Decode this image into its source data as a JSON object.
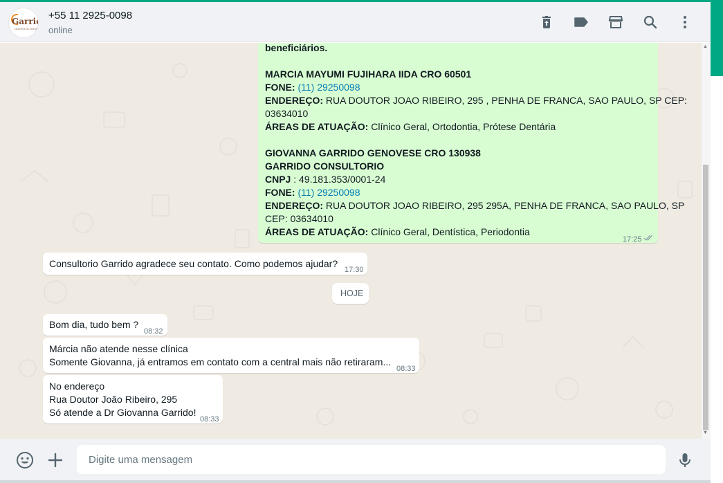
{
  "contact": {
    "name": "+55 11 2925-0098",
    "status": "online",
    "avatar_brand": "Garrido",
    "avatar_sub": "ODONTOLOGIA"
  },
  "header_icons": [
    "delete-icon",
    "label-icon",
    "store-icon",
    "search-icon",
    "menu-icon"
  ],
  "messages": {
    "m1": {
      "lines": {
        "l0": "beneficiários.",
        "l1": "MARCIA MAYUMI FUJIHARA IIDA CRO 60501",
        "l2_k": "FONE:",
        "l2_v": "(11) 29250098",
        "l3_k": "ENDEREÇO:",
        "l3_v": "RUA DOUTOR JOAO RIBEIRO, 295 , PENHA DE FRANCA, SAO PAULO, SP CEP:",
        "l4": "03634010",
        "l5_k": "ÁREAS DE ATUAÇÃO:",
        "l5_v": "Clínico Geral, Ortodontia, Prótese Dentária",
        "l6": "GIOVANNA GARRIDO GENOVESE CRO 130938",
        "l7": "GARRIDO CONSULTORIO",
        "l8_k": "CNPJ",
        "l8_v": ": 49.181.353/0001-24",
        "l9_k": "FONE:",
        "l9_v": "(11) 29250098",
        "l10_k": "ENDEREÇO:",
        "l10_v": "RUA DOUTOR JOAO RIBEIRO, 295 295A, PENHA DE FRANCA, SAO PAULO, SP",
        "l11": "CEP: 03634010",
        "l12_k": "ÁREAS DE ATUAÇÃO:",
        "l12_v": "Clínico Geral, Dentística, Periodontia"
      },
      "time": "17:25"
    },
    "m2": {
      "text": "Consultorio Garrido agradece seu contato. Como podemos ajudar?",
      "time": "17:30"
    },
    "date_divider": "HOJE",
    "m3": {
      "text": "Bom dia, tudo bem ?",
      "time": "08:32"
    },
    "m4": {
      "line1": "Márcia não atende nesse clínica",
      "line2": "Somente Giovanna, já entramos em contato com a central mais não retiraram...",
      "time": "08:33"
    },
    "m5": {
      "line1": "No endereço",
      "line2": "Rua Doutor João Ribeiro, 295",
      "line3": "Só atende a Dr Giovanna Garrido!",
      "time": "08:33"
    }
  },
  "composer": {
    "placeholder": "Digite uma mensagem"
  },
  "colors": {
    "header_bg": "#f0f2f5",
    "chat_bg": "#efeae2",
    "outgoing_bubble": "#d9fdd3",
    "incoming_bubble": "#ffffff",
    "link": "#027eb5",
    "accent": "#00a884"
  }
}
